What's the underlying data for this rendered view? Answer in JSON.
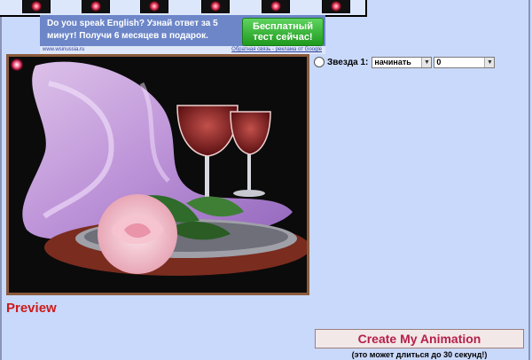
{
  "thumbnails": [
    {
      "icon": "star-sparkle-thumb"
    },
    {
      "icon": "star-sparkle-thumb"
    },
    {
      "icon": "star-sparkle-thumb"
    },
    {
      "icon": "star-sparkle-thumb"
    },
    {
      "icon": "star-sparkle-thumb"
    },
    {
      "icon": "star-sparkle-thumb"
    }
  ],
  "ad": {
    "text": "Do you speak English?  Узнай ответ за 5 минут!  Получи 6 месяцев в подарок.",
    "button_line1": "Бесплатный",
    "button_line2": "тест сейчас!",
    "url": "www.wsinussia.ru",
    "feedback": "Обратная связь - реклама от Google"
  },
  "star_control": {
    "label": "Звезда 1:",
    "action_value": "начинать",
    "number_value": "0"
  },
  "preview_label": "Preview",
  "create_button": "Create My Animation",
  "create_note": "(это может длиться до 30 секунд!)",
  "colors": {
    "page_bg": "#c9d9fb",
    "preview_red": "#cc1a1a",
    "create_text": "#b5204a",
    "image_frame": "#8b5a3c"
  }
}
